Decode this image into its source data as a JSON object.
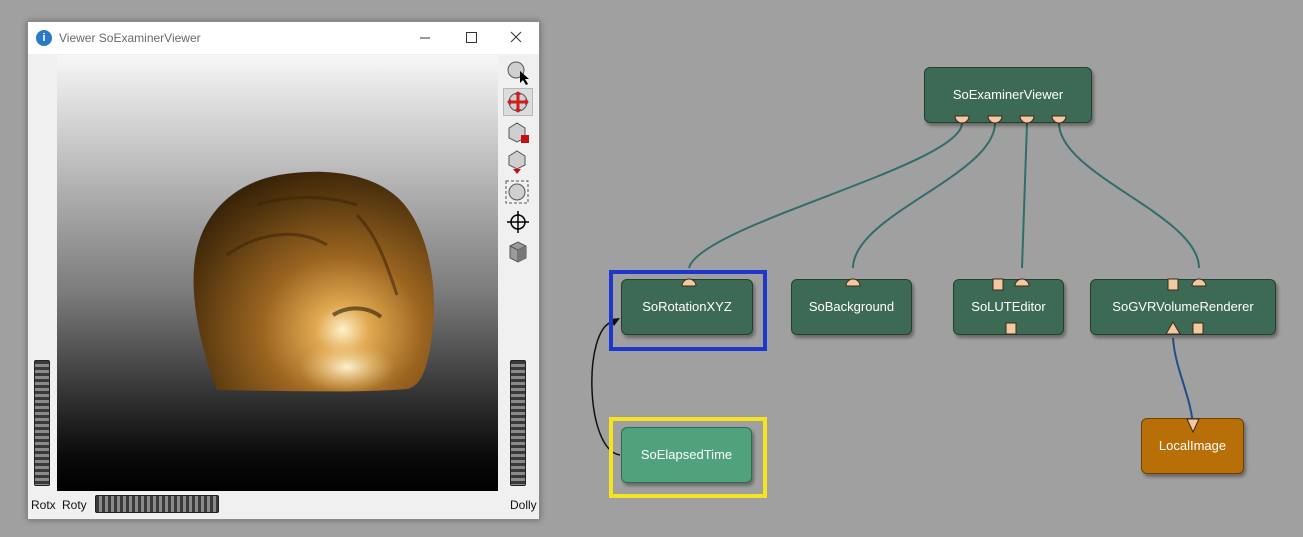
{
  "window": {
    "title": "Viewer SoExaminerViewer",
    "wheels": {
      "rotx": "Rotx",
      "roty": "Roty",
      "dolly": "Dolly"
    },
    "tools": [
      "pick-icon",
      "view-rotate-icon",
      "home-icon",
      "set-home-icon",
      "view-all-icon",
      "seek-icon",
      "projection-icon"
    ]
  },
  "network": {
    "modules": {
      "examiner": "SoExaminerViewer",
      "rotation": "SoRotationXYZ",
      "background": "SoBackground",
      "luteditor": "SoLUTEditor",
      "volrender": "SoGVRVolumeRenderer",
      "elapsed": "SoElapsedTime",
      "localimage": "LocalImage"
    },
    "colors": {
      "module": "#3d6a55",
      "module_selected_light": "#4fa27c",
      "module_image": "#b96f07",
      "connection_inventor": "#2f6e6a",
      "connection_image": "#1f4f8a",
      "selection_blue": "#1b37ce",
      "selection_yellow": "#f7e421"
    }
  }
}
